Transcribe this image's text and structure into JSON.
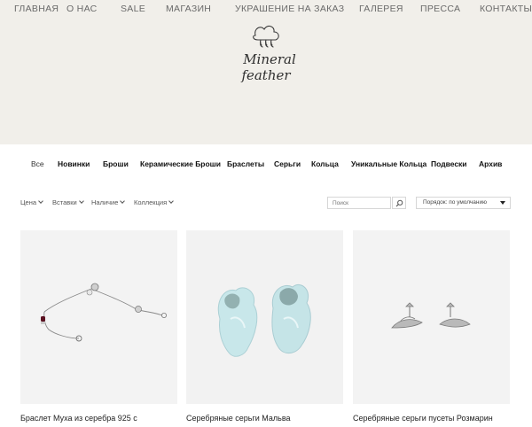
{
  "topnav": {
    "items": [
      "ГЛАВНАЯ",
      "О НАС",
      "SALE",
      "МАГАЗИН",
      "УКРАШЕНИЕ НА ЗАКАЗ",
      "ГАЛЕРЕЯ",
      "ПРЕССА",
      "КОНТАКТЫ"
    ]
  },
  "logo": {
    "line1": "Mineral",
    "line2": "feather"
  },
  "categories": {
    "items": [
      "Все",
      "Новинки",
      "Броши",
      "Керамические Броши",
      "Браслеты",
      "Серьги",
      "Кольца",
      "Уникальные Кольца",
      "Подвески",
      "Архив"
    ]
  },
  "filters": {
    "items": [
      "Цена",
      "Вставки",
      "Наличие",
      "Коллекция"
    ]
  },
  "search": {
    "placeholder": "Поиск"
  },
  "sort": {
    "label": "Порядок: по умолчанию"
  },
  "products": [
    {
      "title": "Браслет Муха из серебра 925 с"
    },
    {
      "title": "Серебряные серьги Мальва"
    },
    {
      "title": "Серебряные серьги пусеты Розмарин"
    }
  ],
  "colors": {
    "header_bg": "#f1efea",
    "card_bg": "#f2f2f2",
    "text": "#222222",
    "nav_text": "#6a6a6a"
  }
}
